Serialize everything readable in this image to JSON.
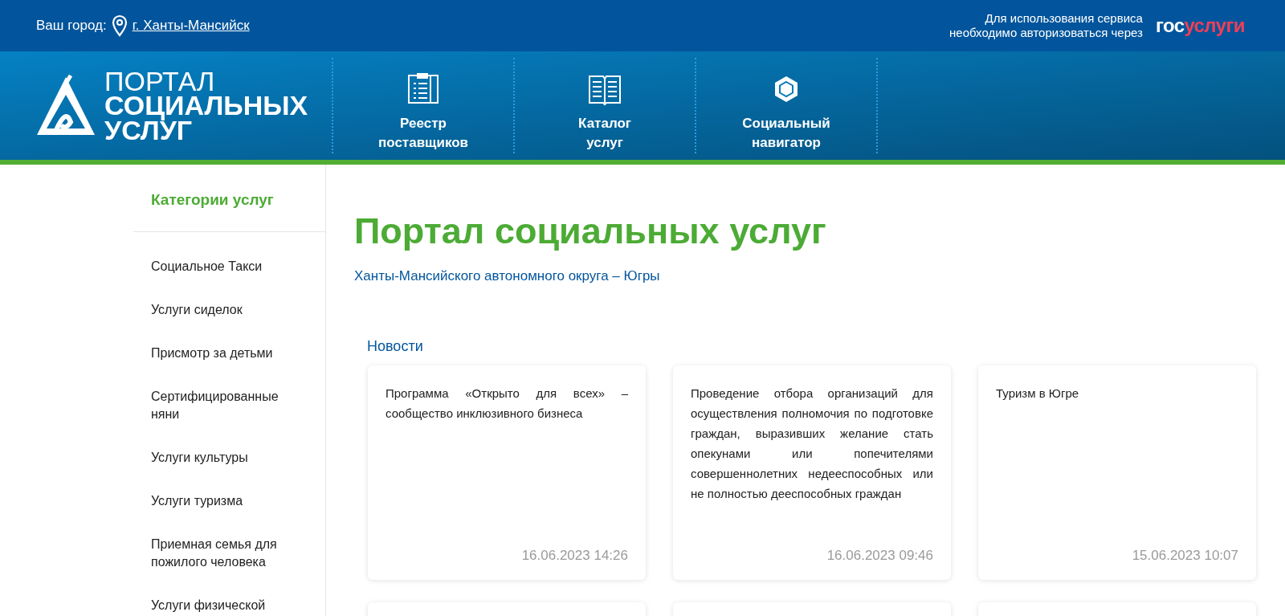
{
  "top_bar": {
    "city_label": "Ваш город:",
    "city": "г. Ханты-Мансийск",
    "auth_note": [
      "Для использования сервиса",
      "необходимо авторизоваться через"
    ],
    "gosuslugi": {
      "part_1": "гос",
      "part_2": "услуги"
    }
  },
  "logo": {
    "line_1": "ПОРТАЛ",
    "line_2": "СОЦИАЛЬНЫХ",
    "line_3": "УСЛУГ"
  },
  "nav": [
    {
      "kind": "registry",
      "label": [
        "Реестр",
        "поставщиков"
      ]
    },
    {
      "kind": "catalog",
      "label": [
        "Каталог",
        "услуг"
      ]
    },
    {
      "kind": "navigator",
      "label": [
        "Социальный",
        "навигатор"
      ]
    }
  ],
  "sidebar": {
    "title": "Категории услуг",
    "items": [
      "Социальное Такси",
      "Услуги сиделок",
      "Присмотр за детьми",
      "Сертифицированные няни",
      "Услуги культуры",
      "Услуги туризма",
      "Приемная семья для пожилого человека",
      "Услуги физической"
    ]
  },
  "main": {
    "title": "Портал социальных услуг",
    "subtitle": "Ханты-Мансийского автономного округа – Югры",
    "news_heading": "Новости",
    "news": [
      {
        "text": "Программа «Открыто для всех» – сообщество инклюзивного бизнеса",
        "date": "16.06.2023 14:26"
      },
      {
        "text": "Проведение отбора организаций для осуществления полномочия по подготовке граждан, выразивших желание стать опекунами или попечителями совершеннолетних недееспособных или не полностью дееспособных граждан",
        "date": "16.06.2023 09:46"
      },
      {
        "text": "Туризм в Югре",
        "date": "15.06.2023 10:07"
      }
    ]
  }
}
